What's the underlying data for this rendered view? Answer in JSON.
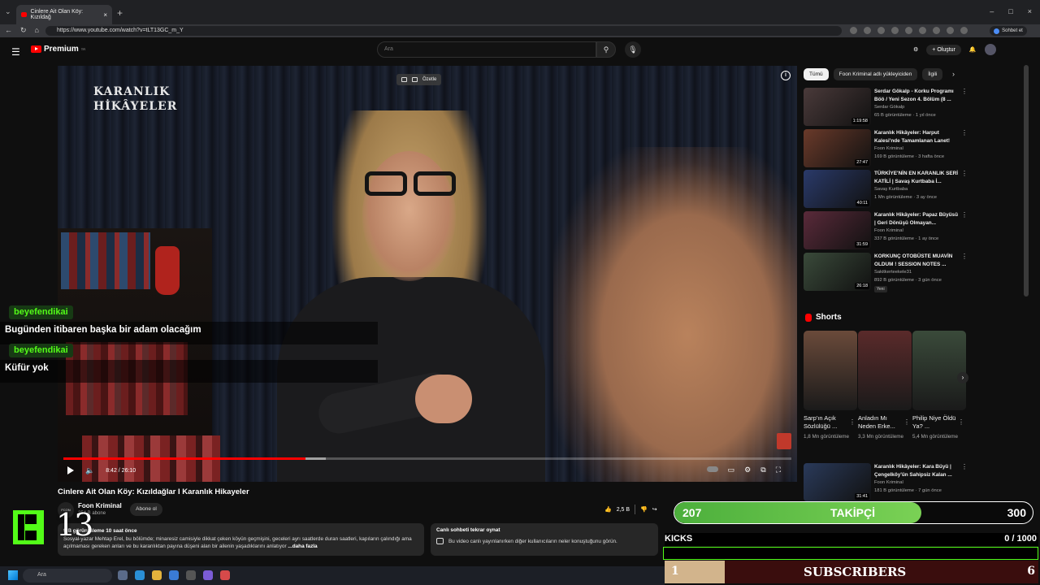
{
  "browser": {
    "tab_title": "Cinlere Ait Olan Köy: Kızıldağ",
    "url": "https://www.youtube.com/watch?v=tLT13GC_m_Y",
    "chat_button": "Sohbet et"
  },
  "yt_header": {
    "logo": "Premium",
    "logo_region": "TR",
    "search_placeholder": "Ara",
    "create_label": "Oluştur"
  },
  "player": {
    "brand_logo_line1": "KARANLIK",
    "brand_logo_line2": "HİKÂYELER",
    "summarize_label": "Özetle",
    "time": "8:42 / 26:10",
    "progress_fraction": 0.333,
    "buffer_fraction": 0.36
  },
  "video": {
    "title": "Cinlere Ait Olan Köy: Kızıldağlar I Karanlık Hikayeler",
    "channel_avatar": "FCON",
    "channel": "Foon Kriminal",
    "subscribers": "254 B abone",
    "subscribe_label": "Abone ol",
    "likes": "2,5 B",
    "desc_stats": "9 B görüntüleme  10 saat önce",
    "desc_text": "Sosyal-yazar Mehtap Erel, bu bölümde; minaresiz camisiyle dikkat çeken köyün geçmişini, geceleri ayrı saatlerde duran saatleri, kapıların çalındığı ama açılmaması gereken anları ve bu karanlıktan payına düşeni alan bir ailenin yaşadıklarını anlatıyor",
    "desc_more": "...daha fazla"
  },
  "live_chat": {
    "title": "Canlı sohbeti tekrar oynat",
    "text": "Bu video canlı yayınlanırken diğer kullanıcıların neler konuştuğunu görün."
  },
  "chat_overlay": [
    {
      "user": "beyefendikai",
      "text": "Bugünden itibaren başka bir adam olacağım"
    },
    {
      "user": "beyefendikai",
      "text": "Küfür yok"
    }
  ],
  "chips": [
    "Tümü",
    "Foon Kriminal adlı yükleyiciden",
    "İlgili"
  ],
  "recommendations": [
    {
      "title": "Serdar Gökalp - Korku Programı Böö / Yeni Sezon 4. Bölüm (8 ...",
      "channel": "Serdar Gökalp",
      "meta": "65 B görüntüleme · 1 yıl önce",
      "duration": "1:19:58",
      "thumb_color": "#4a3a3a",
      "badge": ""
    },
    {
      "title": "Karanlık Hikâyeler: Harput Kalesi'nde Tamamlanan Lanet!",
      "channel": "Foon Kriminal",
      "meta": "169 B görüntüleme · 3 hafta önce",
      "duration": "27:47",
      "thumb_color": "#6a3a2a",
      "badge": ""
    },
    {
      "title": "TÜRKİYE'NİN EN KARANLIK SERİ KATİLİ | Savaş Kurtbaba İ...",
      "channel": "Savaş Kurtbaba",
      "meta": "1 Mn görüntüleme · 3 ay önce",
      "duration": "40:11",
      "thumb_color": "#2a3a6a",
      "badge": ""
    },
    {
      "title": "Karanlık Hikâyeler: Papaz Büyüsü | Geri Dönüşü Olmayan...",
      "channel": "Foon Kriminal",
      "meta": "337 B görüntüleme · 1 ay önce",
      "duration": "31:59",
      "thumb_color": "#5a2a3a",
      "badge": ""
    },
    {
      "title": "KORKUNÇ OTOBÜSTE MUAVİN OLDUM ! SESSION NOTES ...",
      "channel": "Sakitkerteekele31",
      "meta": "892 B görüntüleme · 3 gün önce",
      "duration": "26:18",
      "thumb_color": "#3a4a3a",
      "badge": "Yeni"
    },
    {
      "title": "Karanlık Hikâyeler: Kara Büyü | Çengelköy'ün Sahipsiz Kalan ...",
      "channel": "Foon Kriminal",
      "meta": "181 B görüntüleme · 7 gün önce",
      "duration": "31:41",
      "thumb_color": "#2a3a5a",
      "badge": ""
    }
  ],
  "shorts": {
    "header": "Shorts",
    "items": [
      {
        "title": "Sarp'ın Açık Sözlülüğü ...",
        "views": "1,8 Mn görüntüleme",
        "thumb_color": "#6a4a3a"
      },
      {
        "title": "Anladın Mı Neden Erke...",
        "views": "3,3 Mn görüntüleme",
        "thumb_color": "#5a2a2a"
      },
      {
        "title": "Philip Niye Öldü Ya? ...",
        "views": "5,4 Mn görüntüleme",
        "thumb_color": "#3a4a3a"
      }
    ]
  },
  "stream": {
    "kick_count": "13",
    "follow_current": "207",
    "follow_label": "TAKİPÇİ",
    "follow_goal": "300",
    "follow_fraction": 0.69,
    "kicks_label": "KICKS",
    "kicks_value": "0  / 1000",
    "subs_current": "1",
    "subs_label": "SUBSCRIBERS",
    "subs_goal": "6",
    "subs_fraction": 0.16
  },
  "taskbar": {
    "search_placeholder": "Ara"
  }
}
